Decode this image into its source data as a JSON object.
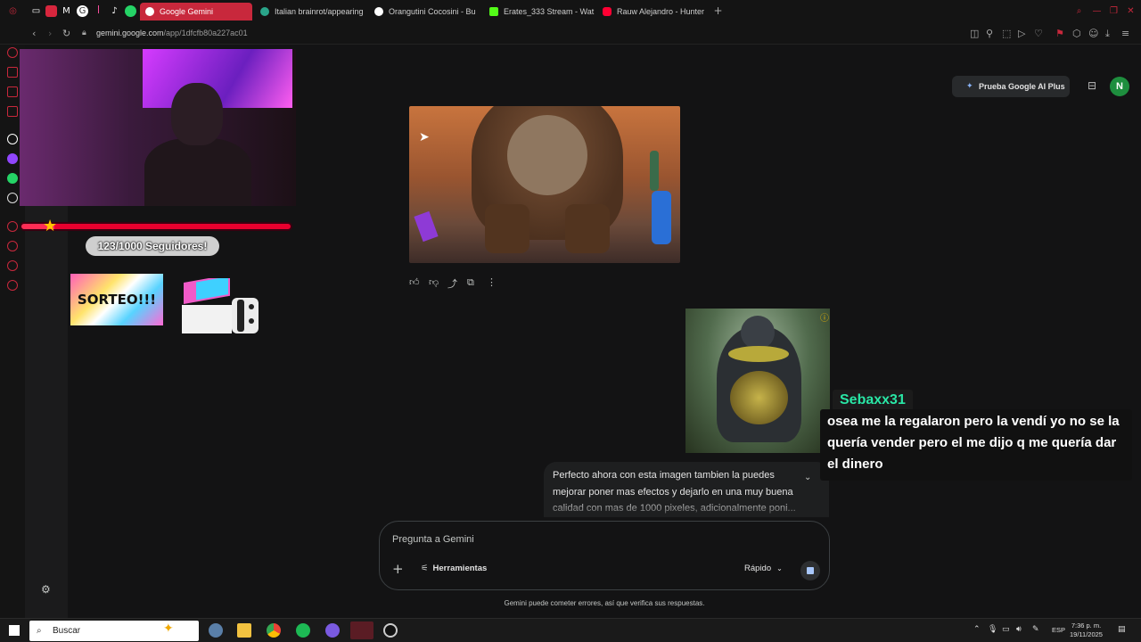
{
  "browser": {
    "tabs": [
      {
        "label": "Google Gemini",
        "active": true
      },
      {
        "label": "Italian brainrot/appearing",
        "active": false
      },
      {
        "label": "Orangutini Cocosini - Bu",
        "active": false
      },
      {
        "label": "Erates_333 Stream - Wat",
        "active": false
      },
      {
        "label": "Rauw Alejandro - Hunter",
        "active": false
      }
    ],
    "new_tab_glyph": "+",
    "url_host": "gemini.google.com",
    "url_path": "/app/1dfcfb80a227ac01"
  },
  "stream_overlay": {
    "followers_text": "123/1000 Seguidores!",
    "followers_progress": 0.123,
    "sorteo_label": "SORTEO!!!",
    "chat_user": "Sebaxx31",
    "chat_message": "osea me la regalaron pero la vendí yo no se la quería vender pero el me dijo q me quería dar el dinero"
  },
  "gemini": {
    "upgrade_button": "Prueba Google AI Plus",
    "avatar_letter": "N",
    "response_text": "Perfecto ahora con esta imagen tambien la puedes mejorar poner mas efectos y dejarlo en una muy buena calidad con mas de 1000 pixeles, adicionalmente poni...",
    "prompt_placeholder": "Pregunta a Gemini",
    "tools_label": "Herramientas",
    "mode_label": "Rápido",
    "disclaimer": "Gemini puede cometer errores, así que verifica sus respuestas."
  },
  "taskbar": {
    "search_placeholder": "Buscar",
    "language": "ESP",
    "time": "7:36 p. m.",
    "date": "19/11/2025"
  },
  "colors": {
    "accent": "#c8283c",
    "gemini_bg": "#131314",
    "chat_user": "#29e6a5"
  }
}
